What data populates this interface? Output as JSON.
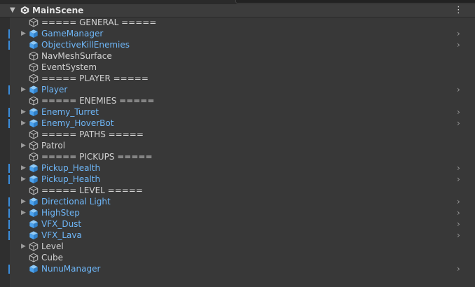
{
  "scene": {
    "title": "MainScene",
    "icon": "unity-scene-icon",
    "menu_icon": "kebab-menu-icon"
  },
  "colors": {
    "prefab_text": "#6eb6f7",
    "plain_text": "#d2d2d2",
    "prefab_cube": "#4da3ee",
    "plain_cube": "#bdbdbd",
    "modified_bar": "#3a8ddc",
    "background": "#383838"
  },
  "hierarchy": [
    {
      "label": "===== GENERAL =====",
      "prefab": false,
      "foldout": false,
      "modified": false,
      "chevron": false
    },
    {
      "label": "GameManager",
      "prefab": true,
      "foldout": true,
      "modified": true,
      "chevron": true
    },
    {
      "label": "ObjectiveKillEnemies",
      "prefab": true,
      "foldout": false,
      "modified": true,
      "chevron": true
    },
    {
      "label": "NavMeshSurface",
      "prefab": false,
      "foldout": false,
      "modified": false,
      "chevron": false
    },
    {
      "label": "EventSystem",
      "prefab": false,
      "foldout": false,
      "modified": false,
      "chevron": false
    },
    {
      "label": "===== PLAYER =====",
      "prefab": false,
      "foldout": false,
      "modified": false,
      "chevron": false
    },
    {
      "label": "Player",
      "prefab": true,
      "foldout": true,
      "modified": true,
      "chevron": true
    },
    {
      "label": "===== ENEMIES =====",
      "prefab": false,
      "foldout": false,
      "modified": false,
      "chevron": false
    },
    {
      "label": "Enemy_Turret",
      "prefab": true,
      "foldout": true,
      "modified": true,
      "chevron": true
    },
    {
      "label": "Enemy_HoverBot",
      "prefab": true,
      "foldout": true,
      "modified": true,
      "chevron": true
    },
    {
      "label": "===== PATHS =====",
      "prefab": false,
      "foldout": false,
      "modified": false,
      "chevron": false
    },
    {
      "label": "Patrol",
      "prefab": false,
      "foldout": true,
      "modified": false,
      "chevron": false
    },
    {
      "label": "===== PICKUPS =====",
      "prefab": false,
      "foldout": false,
      "modified": false,
      "chevron": false
    },
    {
      "label": "Pickup_Health",
      "prefab": true,
      "foldout": true,
      "modified": true,
      "chevron": true
    },
    {
      "label": "Pickup_Health",
      "prefab": true,
      "foldout": true,
      "modified": true,
      "chevron": true
    },
    {
      "label": "===== LEVEL =====",
      "prefab": false,
      "foldout": false,
      "modified": false,
      "chevron": false
    },
    {
      "label": "Directional Light",
      "prefab": true,
      "foldout": true,
      "modified": true,
      "chevron": true
    },
    {
      "label": "HighStep",
      "prefab": true,
      "foldout": true,
      "modified": true,
      "chevron": true
    },
    {
      "label": "VFX_Dust",
      "prefab": true,
      "foldout": false,
      "modified": true,
      "chevron": true
    },
    {
      "label": "VFX_Lava",
      "prefab": true,
      "foldout": false,
      "modified": true,
      "chevron": true
    },
    {
      "label": "Level",
      "prefab": false,
      "foldout": true,
      "modified": false,
      "chevron": false
    },
    {
      "label": "Cube",
      "prefab": false,
      "foldout": false,
      "modified": false,
      "chevron": false
    },
    {
      "label": "NunuManager",
      "prefab": true,
      "foldout": false,
      "modified": true,
      "chevron": true
    }
  ]
}
